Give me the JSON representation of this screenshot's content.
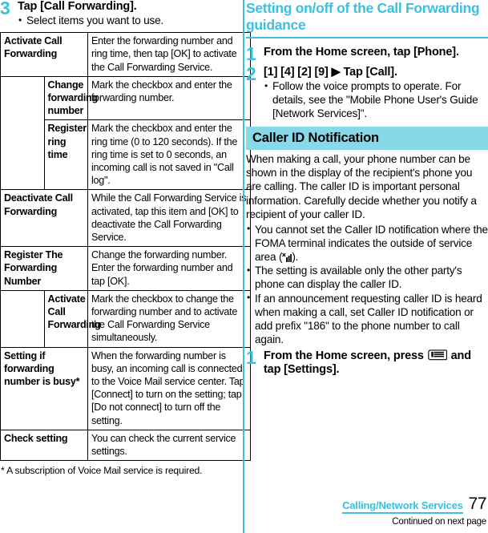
{
  "colors": {
    "accent": "#3cc0e0",
    "band_bg": "#87d9ea",
    "text": "#000000"
  },
  "left_column": {
    "step": {
      "number": "3",
      "title": "Tap [Call Forwarding].",
      "bullets": [
        "Select items you want to use."
      ]
    },
    "table": {
      "rows": [
        {
          "indent": false,
          "label": "Activate Call Forwarding",
          "desc": "Enter the forwarding number and ring time, then tap [OK] to activate the Call Forwarding Service."
        },
        {
          "indent": true,
          "label": "Change forwarding number",
          "desc": "Mark the checkbox and enter the forwarding number."
        },
        {
          "indent": true,
          "label": "Register ring time",
          "desc": "Mark the checkbox and enter the ring time (0 to 120 seconds). If the ring time is set to 0 seconds, an incoming call is not saved in \"Call log\"."
        },
        {
          "indent": false,
          "label": "Deactivate Call Forwarding",
          "desc": "While the Call Forwarding Service is activated, tap this item and [OK] to deactivate the Call Forwarding Service."
        },
        {
          "indent": false,
          "label": "Register The Forwarding Number",
          "desc": "Change the forwarding number. Enter the forwarding number and tap [OK]."
        },
        {
          "indent": true,
          "label": "Activate Call Forwarding",
          "desc": "Mark the checkbox to change the forwarding number and to activate the Call Forwarding Service simultaneously."
        },
        {
          "indent": false,
          "label": "Setting if forwarding number is busy*",
          "desc": "When the forwarding number is busy, an incoming call is connected to the Voice Mail service center. Tap [Connect] to turn on the setting; tap [Do not connect] to turn off the setting."
        },
        {
          "indent": false,
          "label": "Check setting",
          "desc": "You can check the current service settings."
        }
      ]
    },
    "footnote_mark": "*",
    "footnote": "A subscription of Voice Mail service is required."
  },
  "right_column": {
    "section_title": "Setting on/off of the Call Forwarding guidance",
    "steps": [
      {
        "number": "1",
        "title": "From the Home screen, tap [Phone].",
        "bullets": []
      },
      {
        "number": "2",
        "title": "[1] [4] [2] [9] ▶ Tap [Call].",
        "bullets": [
          "Follow the voice prompts to operate. For details, see the \"Mobile Phone User's Guide [Network Services]\"."
        ]
      }
    ],
    "band_heading": "Caller ID Notification",
    "body_paragraph": "When making a call, your phone number can be shown in the display of the recipient's phone you are calling. The caller ID is important personal information. Carefully decide whether you notify a recipient of your caller ID.",
    "notes": [
      {
        "text_before": "You cannot set the Caller ID notification where the FOMA terminal indicates the outside of service area (",
        "icon": "no-service-area-icon",
        "text_after": ")."
      },
      {
        "text_before": "The setting is available only the other party's phone can display the caller ID.",
        "icon": "",
        "text_after": ""
      },
      {
        "text_before": "If an announcement requesting caller ID is heard when making a call, set Caller ID notification or add prefix \"186\" to the phone number to call again.",
        "icon": "",
        "text_after": ""
      }
    ],
    "final_step": {
      "number": "1",
      "title_before": "From the Home screen, press ",
      "icon": "menu-key-icon",
      "title_after": " and tap [Settings]."
    }
  },
  "footer": {
    "category": "Calling/Network Services",
    "page_number": "77",
    "continued": "Continued on next page"
  }
}
